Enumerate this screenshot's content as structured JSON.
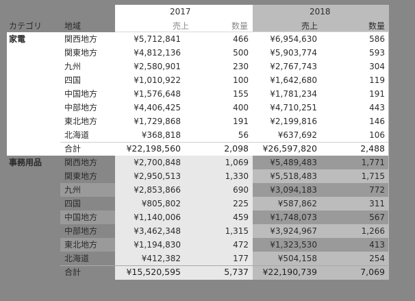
{
  "header": {
    "year_2017": "2017",
    "year_2018": "2018",
    "category_label": "カテゴリ",
    "region_label": "地域",
    "sales_label": "売上",
    "qty_label": "数量"
  },
  "groups": [
    {
      "category": "家電",
      "rows": [
        {
          "region": "関西地方",
          "s2017": "¥5,712,841",
          "q2017": "466",
          "s2018": "¥6,954,630",
          "q2018": "586"
        },
        {
          "region": "関東地方",
          "s2017": "¥4,812,136",
          "q2017": "500",
          "s2018": "¥5,903,774",
          "q2018": "593"
        },
        {
          "region": "九州",
          "s2017": "¥2,580,901",
          "q2017": "230",
          "s2018": "¥2,767,743",
          "q2018": "304"
        },
        {
          "region": "四国",
          "s2017": "¥1,010,922",
          "q2017": "100",
          "s2018": "¥1,642,680",
          "q2018": "119"
        },
        {
          "region": "中国地方",
          "s2017": "¥1,576,648",
          "q2017": "155",
          "s2018": "¥1,781,234",
          "q2018": "191"
        },
        {
          "region": "中部地方",
          "s2017": "¥4,406,425",
          "q2017": "400",
          "s2018": "¥4,710,251",
          "q2018": "443"
        },
        {
          "region": "東北地方",
          "s2017": "¥1,729,868",
          "q2017": "191",
          "s2018": "¥2,199,816",
          "q2018": "146"
        },
        {
          "region": "北海道",
          "s2017": "¥368,818",
          "q2017": "56",
          "s2018": "¥637,692",
          "q2018": "106"
        },
        {
          "region": "合計",
          "s2017": "¥22,198,560",
          "q2017": "2,098",
          "s2018": "¥26,597,820",
          "q2018": "2,488"
        }
      ]
    },
    {
      "category": "事務用品",
      "rows": [
        {
          "region": "関西地方",
          "s2017": "¥2,700,848",
          "q2017": "1,069",
          "s2018": "¥5,489,483",
          "q2018": "1,771"
        },
        {
          "region": "関東地方",
          "s2017": "¥2,950,513",
          "q2017": "1,330",
          "s2018": "¥5,518,483",
          "q2018": "1,715"
        },
        {
          "region": "九州",
          "s2017": "¥2,853,866",
          "q2017": "690",
          "s2018": "¥3,094,183",
          "q2018": "772"
        },
        {
          "region": "四国",
          "s2017": "¥805,802",
          "q2017": "225",
          "s2018": "¥587,862",
          "q2018": "311"
        },
        {
          "region": "中国地方",
          "s2017": "¥1,140,006",
          "q2017": "459",
          "s2018": "¥1,748,073",
          "q2018": "567"
        },
        {
          "region": "中部地方",
          "s2017": "¥3,462,348",
          "q2017": "1,315",
          "s2018": "¥3,924,967",
          "q2018": "1,266"
        },
        {
          "region": "東北地方",
          "s2017": "¥1,194,830",
          "q2017": "472",
          "s2018": "¥1,323,530",
          "q2018": "413"
        },
        {
          "region": "北海道",
          "s2017": "¥412,382",
          "q2017": "177",
          "s2018": "¥504,158",
          "q2018": "254"
        },
        {
          "region": "合計",
          "s2017": "¥15,520,595",
          "q2017": "5,737",
          "s2018": "¥22,190,739",
          "q2018": "7,069"
        }
      ]
    }
  ],
  "colors": {
    "background": "#878787",
    "highlight": "#ffffff",
    "band_2018": "#bcbcbc"
  }
}
